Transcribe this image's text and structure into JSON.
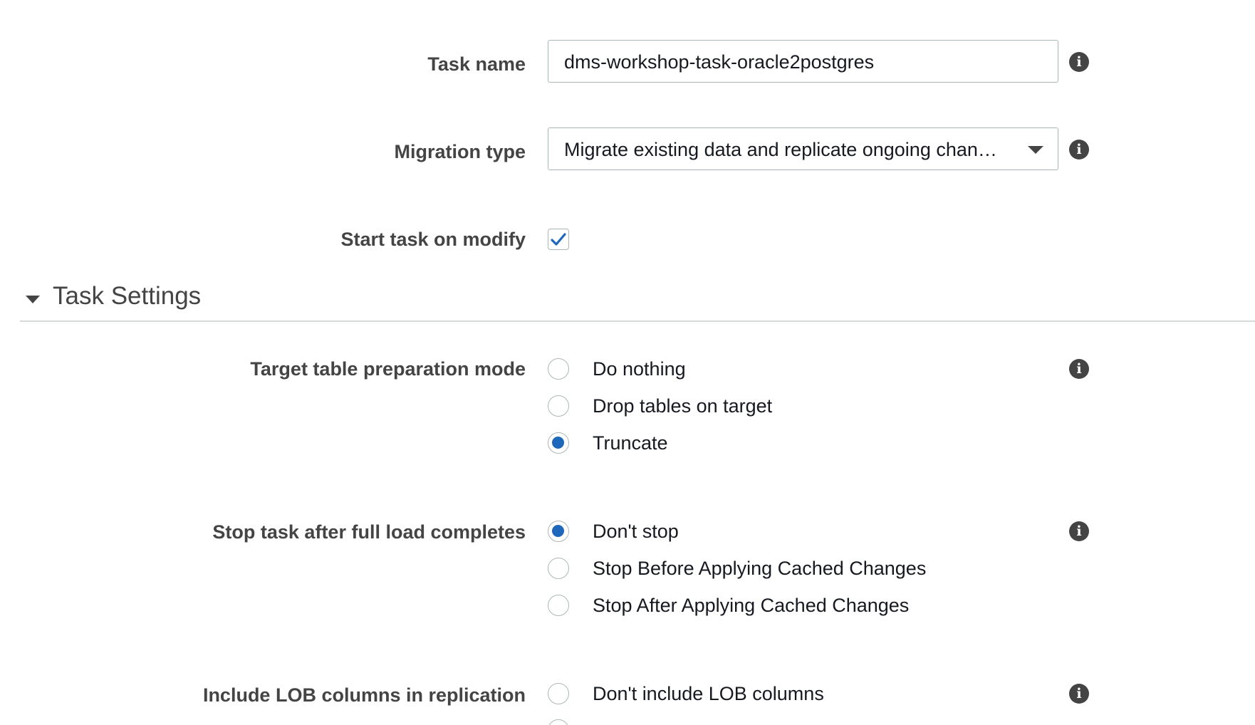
{
  "form": {
    "task_name": {
      "label": "Task name",
      "value": "dms-workshop-task-oracle2postgres"
    },
    "migration_type": {
      "label": "Migration type",
      "selected": "Migrate existing data and replicate ongoing changes"
    },
    "start_task_on_modify": {
      "label": "Start task on modify",
      "checked": true
    }
  },
  "task_settings": {
    "title": "Task Settings",
    "target_table_prep": {
      "label": "Target table preparation mode",
      "options": [
        "Do nothing",
        "Drop tables on target",
        "Truncate"
      ],
      "selected": "Truncate"
    },
    "stop_task": {
      "label": "Stop task after full load completes",
      "options": [
        "Don't stop",
        "Stop Before Applying Cached Changes",
        "Stop After Applying Cached Changes"
      ],
      "selected": "Don't stop"
    },
    "include_lob": {
      "label": "Include LOB columns in replication",
      "options": [
        "Don't include LOB columns"
      ]
    }
  },
  "icons": {
    "info": "info-icon",
    "info_glyph": "i"
  },
  "colors": {
    "accent": "#1d68ba",
    "label": "#444444",
    "border": "#aab7b8"
  }
}
